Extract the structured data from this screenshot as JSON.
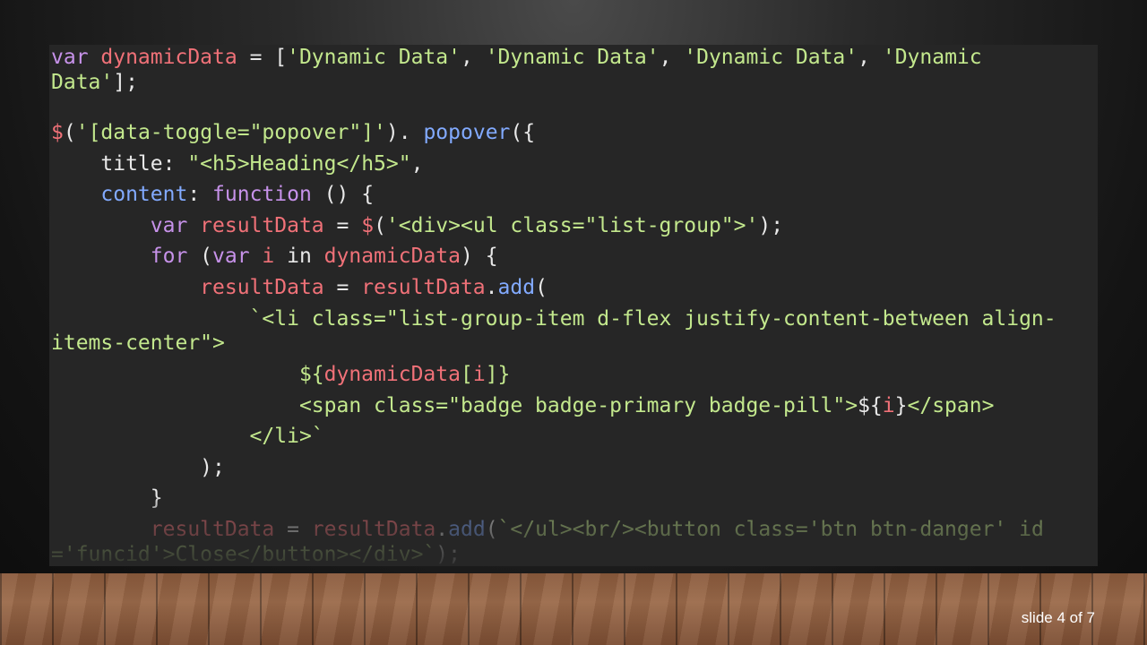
{
  "code_lines": [
    [
      [
        "kw",
        "var "
      ],
      [
        "vr",
        "dynamicData"
      ],
      [
        "pl",
        " = ["
      ],
      [
        "st",
        "'Dynamic Data'"
      ],
      [
        "pl",
        ", "
      ],
      [
        "st",
        "'Dynamic Data'"
      ],
      [
        "pl",
        ", "
      ],
      [
        "st",
        "'Dynamic Data'"
      ],
      [
        "pl",
        ", "
      ],
      [
        "st",
        "'Dynamic"
      ]
    ],
    [
      [
        "st",
        "Data'"
      ],
      [
        "pl",
        "];"
      ]
    ],
    [
      [
        "vr",
        "$"
      ],
      [
        "pl",
        "("
      ],
      [
        "st",
        "'[data-toggle=\"popover\"]'"
      ],
      [
        "pl",
        "). "
      ],
      [
        "fn",
        "popover"
      ],
      [
        "pl",
        "({"
      ]
    ],
    [
      [
        "pl",
        "    title: "
      ],
      [
        "st",
        "\"<h5>Heading</h5>\""
      ],
      [
        "pl",
        ","
      ]
    ],
    [
      [
        "fn",
        "    content"
      ],
      [
        "pl",
        ": "
      ],
      [
        "kw",
        "function"
      ],
      [
        "pl",
        " () {"
      ]
    ],
    [
      [
        "kw",
        "        var "
      ],
      [
        "vr",
        "resultData"
      ],
      [
        "pl",
        " = "
      ],
      [
        "vr",
        "$"
      ],
      [
        "pl",
        "("
      ],
      [
        "st",
        "'<div><ul class=\"list-group\">'"
      ],
      [
        "pl",
        ");"
      ]
    ],
    [
      [
        "kw",
        "        for"
      ],
      [
        "pl",
        " ("
      ],
      [
        "kw",
        "var "
      ],
      [
        "vr",
        "i"
      ],
      [
        "pl",
        " in "
      ],
      [
        "vr",
        "dynamicData"
      ],
      [
        "pl",
        ") {"
      ]
    ],
    [
      [
        "vr",
        "            resultData"
      ],
      [
        "pl",
        " = "
      ],
      [
        "vr",
        "resultData"
      ],
      [
        "pl",
        "."
      ],
      [
        "fn",
        "add"
      ],
      [
        "pl",
        "("
      ]
    ],
    [
      [
        "st",
        "                `<li class=\"list-group-item d-flex justify-content-between align-"
      ]
    ],
    [
      [
        "st",
        "items-center\">"
      ]
    ],
    [
      [
        "st",
        "                    ${"
      ],
      [
        "vr",
        "dynamicData"
      ],
      [
        "st",
        "["
      ],
      [
        "vr",
        "i"
      ],
      [
        "st",
        "]}"
      ]
    ],
    [
      [
        "st",
        "                    <span class=\"badge badge-primary badge-pill\">"
      ],
      [
        "pl",
        "${"
      ],
      [
        "vr",
        "i"
      ],
      [
        "pl",
        "}"
      ],
      [
        "st",
        "</span>"
      ]
    ],
    [
      [
        "st",
        "                </li>`"
      ]
    ],
    [
      [
        "pl",
        "            );"
      ]
    ],
    [
      [
        "pl",
        "        }"
      ]
    ],
    [
      [
        "vr",
        "        resultData"
      ],
      [
        "pl",
        " = "
      ],
      [
        "vr",
        "resultData"
      ],
      [
        "pl",
        "."
      ],
      [
        "fn",
        "add"
      ],
      [
        "pl",
        "("
      ],
      [
        "st",
        "`</ul><br/><button class='btn btn-danger' id"
      ]
    ],
    [
      [
        "st",
        "='funcid'>Close</button></div>`"
      ],
      [
        "pl",
        ");"
      ]
    ]
  ],
  "slide_counter": "slide 4 of 7"
}
